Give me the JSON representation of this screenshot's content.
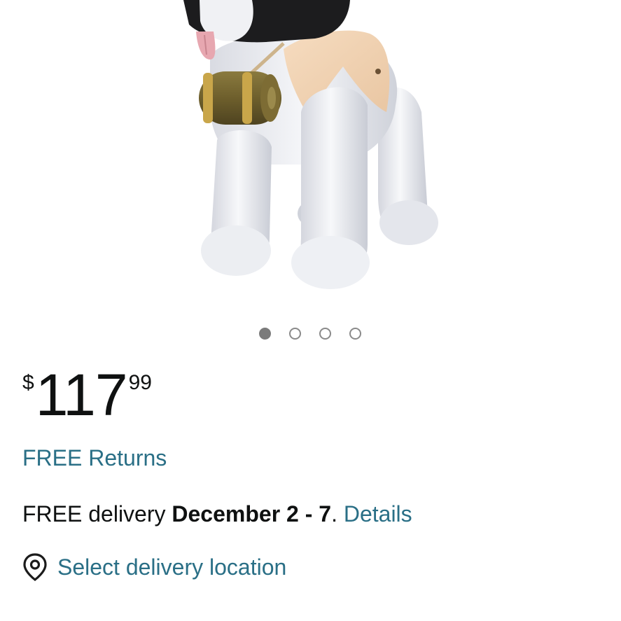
{
  "product": {
    "image_alt": "Inflatable St. Bernard dog with barrel",
    "carousel": {
      "count": 4,
      "active_index": 0
    }
  },
  "price": {
    "symbol": "$",
    "whole": "117",
    "fraction": "99"
  },
  "returns": {
    "label": "FREE Returns"
  },
  "delivery": {
    "prefix": "FREE delivery ",
    "dates": "December 2 - 7",
    "separator": ". ",
    "details_link": "Details"
  },
  "location": {
    "icon": "location-pin-icon",
    "label": "Select delivery location"
  },
  "colors": {
    "link": "#2a6f86",
    "text": "#0f1111",
    "dot_active": "#7b7b7b"
  }
}
